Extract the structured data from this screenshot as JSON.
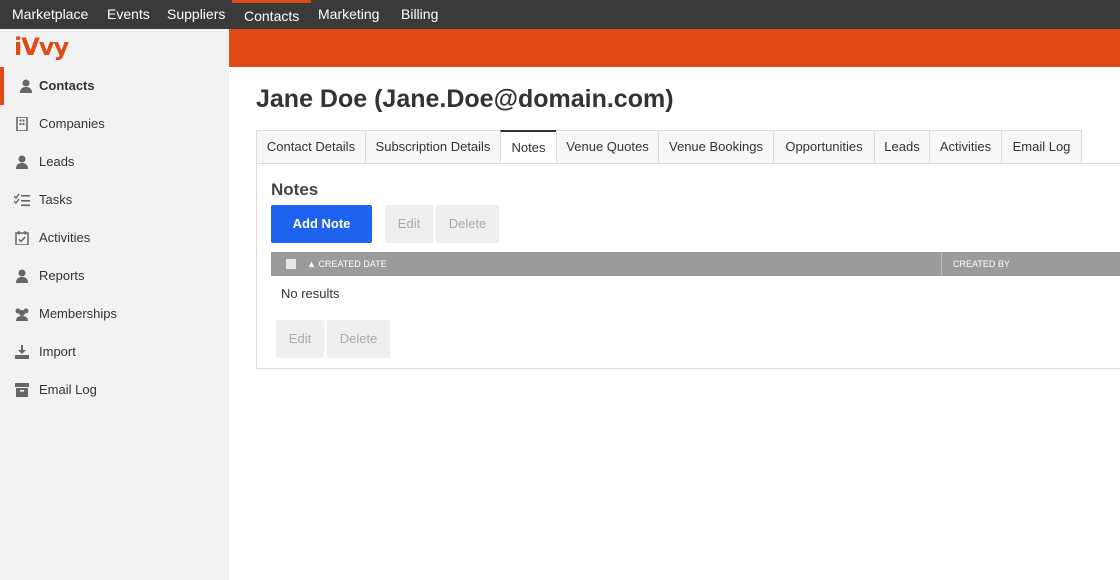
{
  "topnav": {
    "items": [
      "Marketplace",
      "Events",
      "Suppliers",
      "Contacts",
      "Marketing",
      "Billing"
    ]
  },
  "brand": {
    "logo_text": "iVvy",
    "accent": "#e04a16"
  },
  "sidebar": {
    "items": [
      {
        "label": "Contacts",
        "icon": "user-icon"
      },
      {
        "label": "Companies",
        "icon": "building-icon"
      },
      {
        "label": "Leads",
        "icon": "user-icon"
      },
      {
        "label": "Tasks",
        "icon": "tasks-icon"
      },
      {
        "label": "Activities",
        "icon": "calendar-check-icon"
      },
      {
        "label": "Reports",
        "icon": "user-icon"
      },
      {
        "label": "Memberships",
        "icon": "users-icon"
      },
      {
        "label": "Import",
        "icon": "download-icon"
      },
      {
        "label": "Email Log",
        "icon": "archive-icon"
      }
    ]
  },
  "page": {
    "title": "Jane Doe (Jane.Doe@domain.com)"
  },
  "tabs": [
    "Contact Details",
    "Subscription Details",
    "Notes",
    "Venue Quotes",
    "Venue Bookings",
    "Opportunities",
    "Leads",
    "Activities",
    "Email Log"
  ],
  "notes": {
    "title": "Notes",
    "add_label": "Add Note",
    "edit_label": "Edit",
    "delete_label": "Delete",
    "columns": [
      "CREATED DATE",
      "CREATED BY"
    ],
    "empty_text": "No results",
    "sort_indicator": "▲"
  }
}
